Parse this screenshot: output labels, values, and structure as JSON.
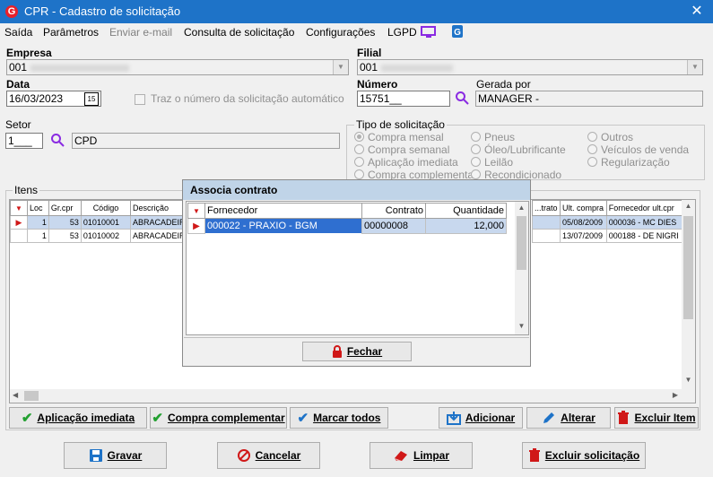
{
  "window": {
    "title": "CPR - Cadastro de solicitação",
    "logo_letter": "G",
    "close_glyph": "✕"
  },
  "menu": {
    "items": [
      "Saída",
      "Parâmetros",
      "Enviar e-mail",
      "Consulta de solicitação",
      "Configurações",
      "LGPD"
    ]
  },
  "form": {
    "empresa_label": "Empresa",
    "empresa_value": "001",
    "filial_label": "Filial",
    "filial_value": "001",
    "data_label": "Data",
    "data_value": "16/03/2023",
    "auto_number_label": "Traz o número da solicitação automático",
    "numero_label": "Número",
    "numero_value": "15751__",
    "gerada_label": "Gerada por",
    "gerada_value": "MANAGER -",
    "setor_label": "Setor",
    "setor_value": "1___",
    "setor_desc": "CPD",
    "calendar_day": "15"
  },
  "tipo": {
    "label": "Tipo de solicitação",
    "col1": [
      "Compra mensal",
      "Compra semanal",
      "Aplicação imediata",
      "Compra complementar"
    ],
    "col2": [
      "Pneus",
      "Óleo/Lubrificante",
      "Leilão",
      "Recondicionado"
    ],
    "col3": [
      "Outros",
      "Veículos de venda",
      "Regularização"
    ],
    "selected": "Compra mensal"
  },
  "itens": {
    "label": "Itens",
    "headers": [
      "Loc",
      "Gr.cpr",
      "Código",
      "Descrição"
    ],
    "right_headers": [
      "...trato",
      "Ult. compra",
      "Fornecedor ult.cpr"
    ],
    "rows": [
      {
        "loc": "1",
        "gr": "53",
        "codigo": "01010001",
        "descricao": "ABRACADEIR",
        "ult_compra": "05/08/2009",
        "fornecedor": "000036 - MC DIES"
      },
      {
        "loc": "1",
        "gr": "53",
        "codigo": "01010002",
        "descricao": "ABRACADEIR",
        "ult_compra": "13/07/2009",
        "fornecedor": "000188 - DE NIGRI"
      }
    ]
  },
  "dialog": {
    "title": "Associa contrato",
    "headers": [
      "Fornecedor",
      "Contrato",
      "Quantidade"
    ],
    "rows": [
      {
        "fornecedor": "000022 - PRAXIO - BGM",
        "contrato": "00000008",
        "quantidade": "12,000"
      }
    ],
    "close_label": "Fechar"
  },
  "buttons": {
    "aplicacao": "Aplicação imediata",
    "complementar": "Compra complementar",
    "marcar": "Marcar todos",
    "adicionar": "Adicionar",
    "alterar": "Alterar",
    "excluir_item": "Excluir Item",
    "gravar": "Gravar",
    "cancelar": "Cancelar",
    "limpar": "Limpar",
    "excluir_solicitacao": "Excluir solicitação"
  },
  "colors": {
    "titlebar": "#1e73c8",
    "selection": "#2f6fd0",
    "arrow": "#d01818"
  }
}
